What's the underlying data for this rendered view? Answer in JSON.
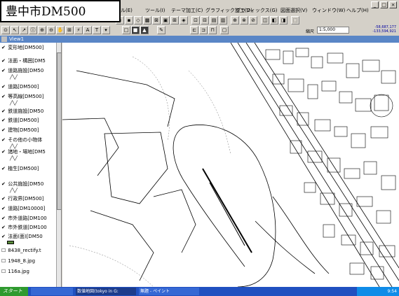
{
  "title_overlay": "豊中市DM500",
  "menus": [
    "ル(E)",
    "ツール(I)",
    "テーマ加工(C)",
    "グラフィック加工(O)",
    "グラフィックス(G)",
    "図面選択(V)",
    "ウィンドウ(W)",
    "ヘルプ(H)"
  ],
  "toolbar": {
    "scale_label": "縮尺",
    "scale_value": "1:5,000",
    "coord_x": "-58,687,177",
    "coord_y": "-133,594,921"
  },
  "view_title": "View1",
  "layers": [
    {
      "label": "変形地[DM500]",
      "checked": true
    },
    {
      "label": "法面・構囲[DM5",
      "checked": true
    },
    {
      "label": "道路施設[DM50",
      "checked": true
    },
    {
      "label": "道路[DM500]",
      "checked": true
    },
    {
      "label": "等高線[DM500]",
      "checked": true
    },
    {
      "label": "鉄道施設[DM50",
      "checked": true
    },
    {
      "label": "鉄道[DM500]",
      "checked": true
    },
    {
      "label": "建物[DM500]",
      "checked": true
    },
    {
      "label": "その他の小物体",
      "checked": true
    },
    {
      "label": "諸地・場地[DM5",
      "checked": true
    },
    {
      "label": "植生[DM500]",
      "checked": true
    },
    {
      "label": "公共施設[DM50",
      "checked": true
    },
    {
      "label": "行政界[DM500]",
      "checked": true
    },
    {
      "label": "道路[DM10000]",
      "checked": true
    },
    {
      "label": "市外道路[DM100",
      "checked": true
    },
    {
      "label": "市外鉄道[DM100",
      "checked": true
    },
    {
      "label": "法面(面)[DM50",
      "checked": true
    },
    {
      "label": "8438_rectify.t",
      "checked": false
    },
    {
      "label": "1948_8.jpg",
      "checked": false
    },
    {
      "label": "116a.jpg",
      "checked": false
    }
  ],
  "taskbar": {
    "start": "スタート",
    "tasks": [
      "",
      "数値地図(tokyo in G:",
      "無題 - ペイント"
    ],
    "clock": "9:54"
  }
}
